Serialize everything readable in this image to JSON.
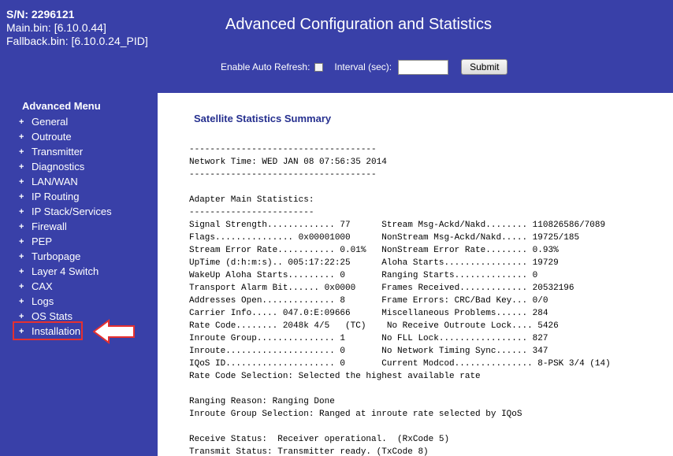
{
  "device": {
    "sn": "S/N: 2296121",
    "main_bin": "Main.bin: [6.10.0.44]",
    "fallback_bin": "Fallback.bin: [6.10.0.24_PID]"
  },
  "header": {
    "title": "Advanced Configuration and Statistics",
    "auto_refresh_label": "Enable Auto Refresh:",
    "interval_label": "Interval (sec):",
    "interval_value": "",
    "submit_label": "Submit"
  },
  "sidebar": {
    "title": "Advanced Menu",
    "items": [
      {
        "label": "General"
      },
      {
        "label": "Outroute"
      },
      {
        "label": "Transmitter"
      },
      {
        "label": "Diagnostics"
      },
      {
        "label": "LAN/WAN"
      },
      {
        "label": "IP Routing"
      },
      {
        "label": "IP Stack/Services"
      },
      {
        "label": "Firewall"
      },
      {
        "label": "PEP"
      },
      {
        "label": "Turbopage"
      },
      {
        "label": "Layer 4 Switch"
      },
      {
        "label": "CAX"
      },
      {
        "label": "Logs"
      },
      {
        "label": "OS Stats"
      },
      {
        "label": "Installation"
      }
    ]
  },
  "content": {
    "title": "Satellite Statistics Summary",
    "lines": [
      "------------------------------------",
      "Network Time: WED JAN 08 07:56:35 2014",
      "------------------------------------",
      "",
      "Adapter Main Statistics:",
      "------------------------",
      "Signal Strength............. 77      Stream Msg-Ackd/Nakd........ 110826586/7089",
      "Flags............... 0x00001000      NonStream Msg-Ackd/Nakd..... 19725/185",
      "Stream Error Rate........... 0.01%   NonStream Error Rate........ 0.93%",
      "UpTime (d:h:m:s).. 005:17:22:25      Aloha Starts................ 19729",
      "WakeUp Aloha Starts......... 0       Ranging Starts.............. 0",
      "Transport Alarm Bit...... 0x0000     Frames Received............. 20532196",
      "Addresses Open.............. 8       Frame Errors: CRC/Bad Key... 0/0",
      "Carrier Info..... 047.0:E:09666      Miscellaneous Problems...... 284",
      "Rate Code........ 2048k 4/5   (TC)    No Receive Outroute Lock.... 5426",
      "Inroute Group............... 1       No FLL Lock................. 827",
      "Inroute..................... 0       No Network Timing Sync...... 347",
      "IQoS ID..................... 0       Current Modcod............... 8-PSK 3/4 (14)",
      "Rate Code Selection: Selected the highest available rate",
      "",
      "Ranging Reason: Ranging Done",
      "Inroute Group Selection: Ranged at inroute rate selected by IQoS",
      "",
      "Receive Status:  Receiver operational.  (RxCode 5)",
      "Transmit Status: Transmitter ready. (TxCode 8)"
    ]
  },
  "annotation": {
    "color": "#e53030"
  }
}
